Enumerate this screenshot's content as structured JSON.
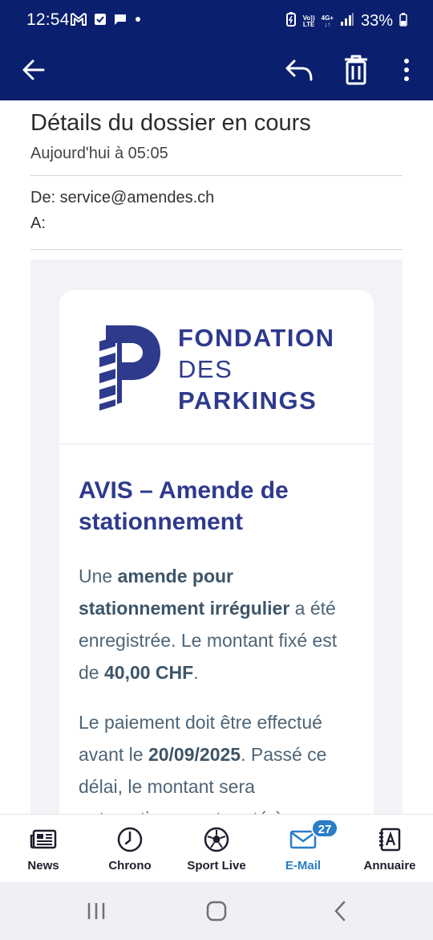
{
  "status_bar": {
    "time": "12:54",
    "network_volte": "VoLTE",
    "network_4g": "4G+",
    "battery": "33%"
  },
  "app_bar": {
    "back_icon": "arrow-left-icon",
    "reply_icon": "reply-icon",
    "delete_icon": "trash-icon",
    "more_icon": "more-vert-icon",
    "background": "#0a1f6e"
  },
  "email": {
    "subject": "Détails du dossier en cours",
    "date": "Aujourd'hui à 05:05",
    "from": "De: service@amendes.ch",
    "to": "A:"
  },
  "card": {
    "logo_line1": "FONDATION",
    "logo_line2": "DES",
    "logo_line3": "PARKINGS",
    "title": "AVIS – Amende de stationnement",
    "p1_a": "Une ",
    "p1_b": "amende pour stationnement irrégulier",
    "p1_c": " a été enregistrée. Le montant fixé est de ",
    "p1_d": "40,00 CHF",
    "p1_e": ".",
    "p2_a": "Le paiement doit être effectué avant le ",
    "p2_b": "20/09/2025",
    "p2_c": ". Passé ce délai, le montant sera automatiquement porté à",
    "brand_color": "#2e3a8c"
  },
  "tabs": [
    {
      "label": "News",
      "icon": "newspaper-icon"
    },
    {
      "label": "Chrono",
      "icon": "clock-icon"
    },
    {
      "label": "Sport Live",
      "icon": "soccer-ball-icon"
    },
    {
      "label": "E-Mail",
      "icon": "mail-icon",
      "active": true
    },
    {
      "label": "Annuaire",
      "icon": "address-book-icon"
    }
  ],
  "email_badge": "27",
  "active_color": "#2a7dc9"
}
